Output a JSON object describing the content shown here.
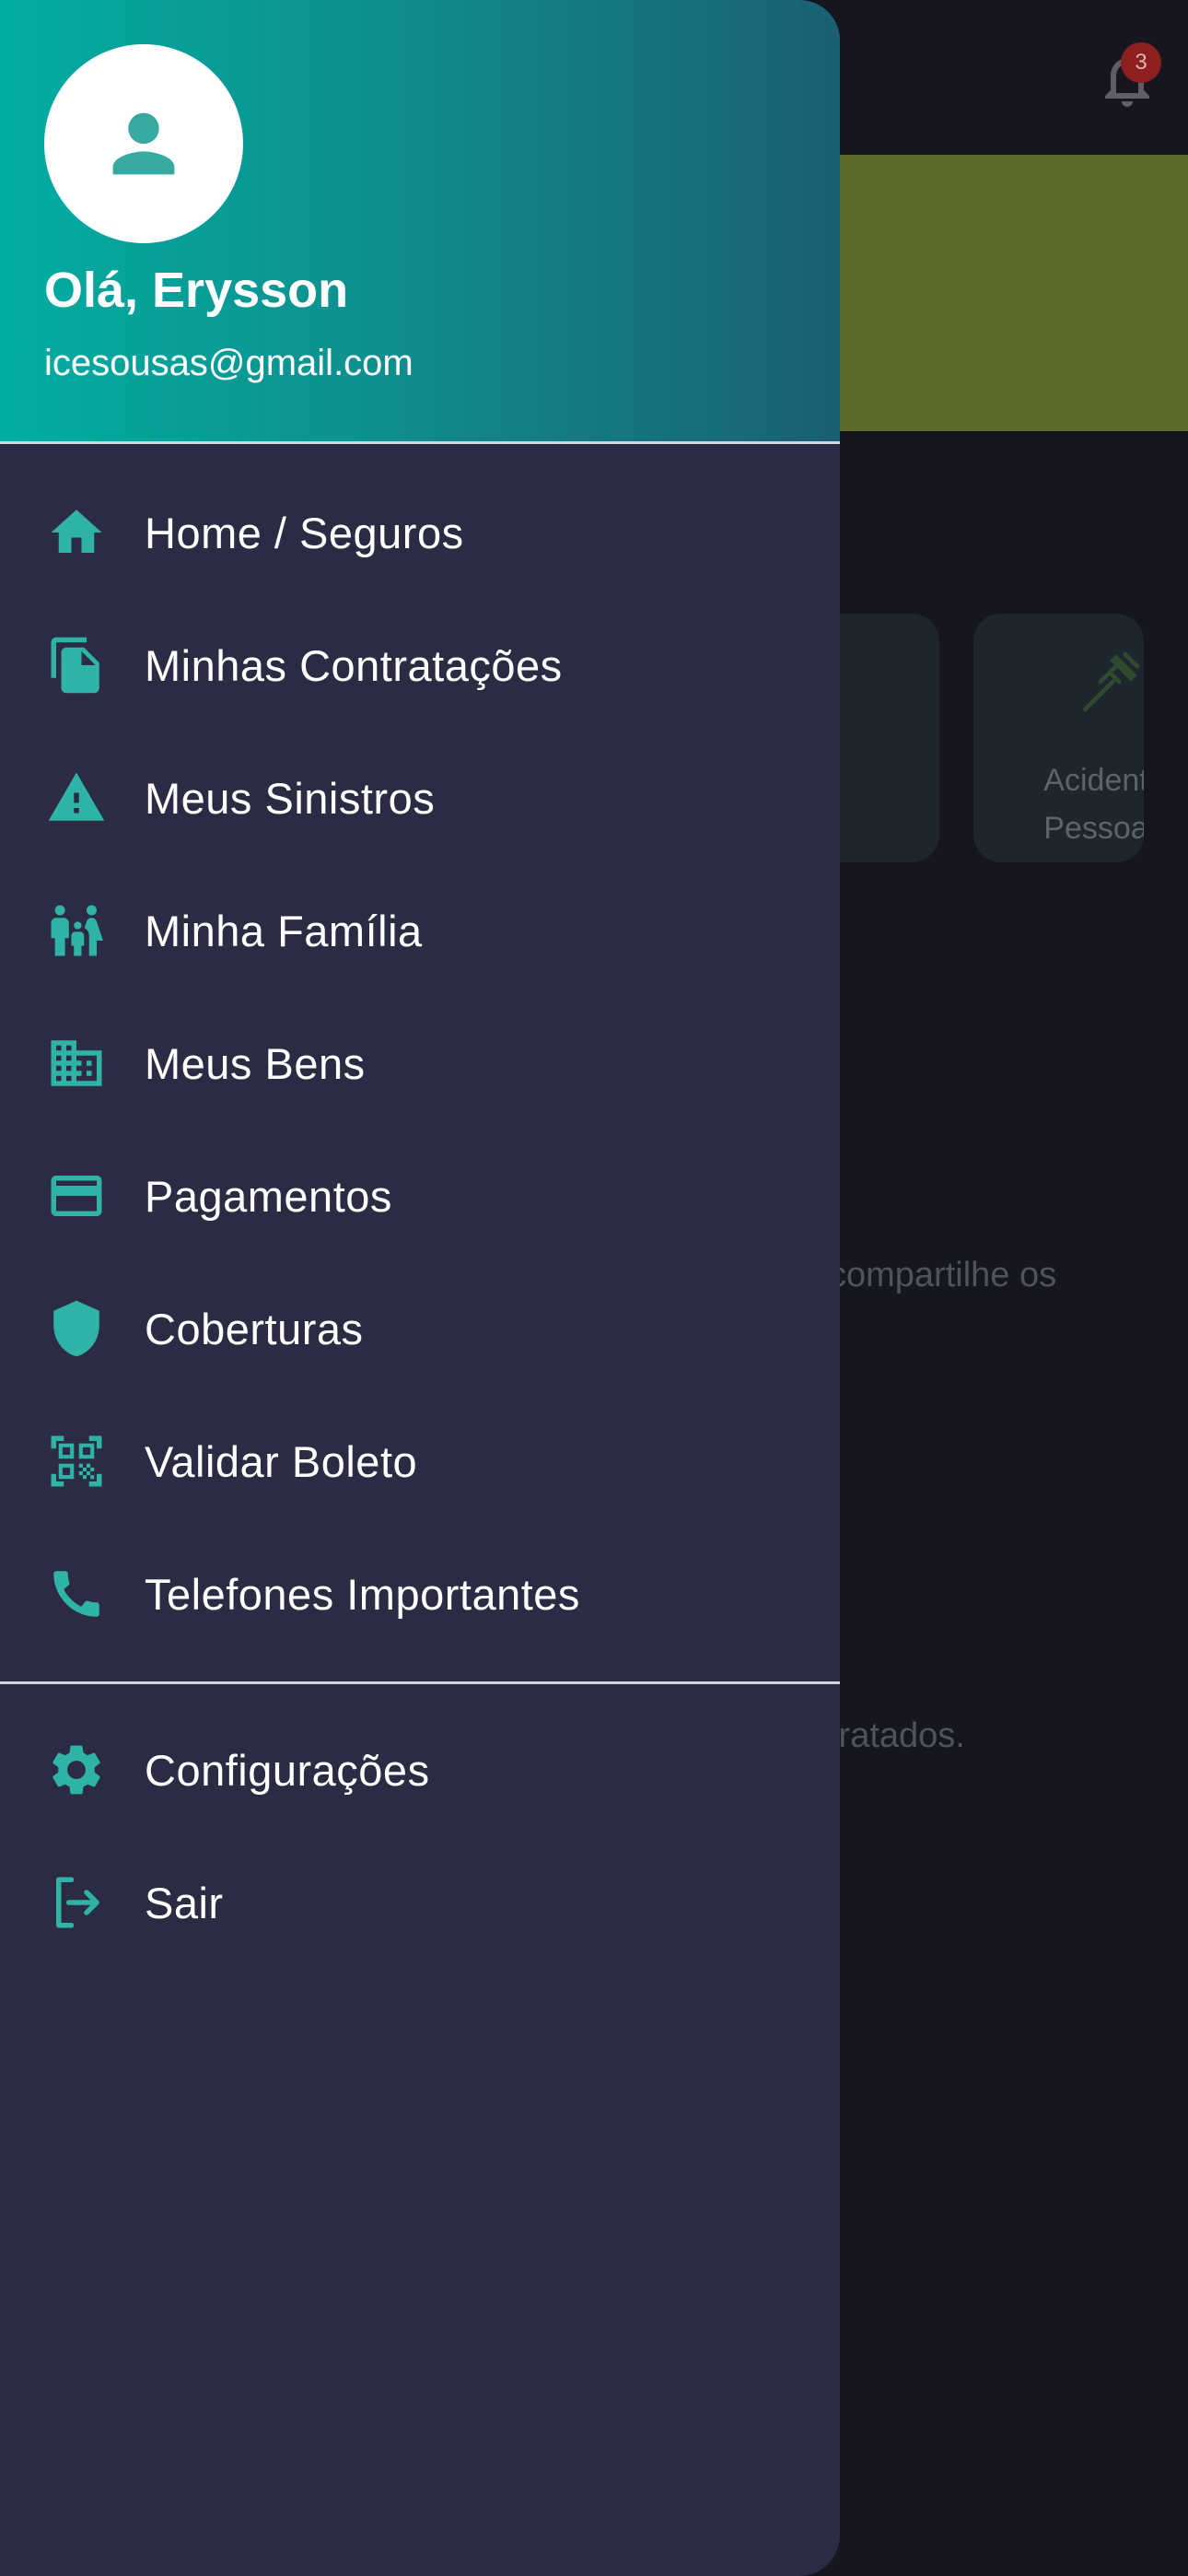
{
  "background": {
    "notification_count": "3",
    "card_label_line1": "Acident",
    "card_label_line2": "Pessoa",
    "text_line1": "compartilhe os",
    "text_line2": "tratados."
  },
  "drawer": {
    "greeting": "Olá, Erysson",
    "email": "icesousas@gmail.com",
    "menu": [
      {
        "label": "Home / Seguros",
        "icon": "home-icon"
      },
      {
        "label": "Minhas Contratações",
        "icon": "documents-icon"
      },
      {
        "label": "Meus Sinistros",
        "icon": "warning-icon"
      },
      {
        "label": "Minha Família",
        "icon": "family-icon"
      },
      {
        "label": "Meus Bens",
        "icon": "building-icon"
      },
      {
        "label": "Pagamentos",
        "icon": "credit-card-icon"
      },
      {
        "label": "Coberturas",
        "icon": "shield-icon"
      },
      {
        "label": "Validar Boleto",
        "icon": "qr-code-icon"
      },
      {
        "label": "Telefones Importantes",
        "icon": "phone-icon"
      }
    ],
    "footer_menu": [
      {
        "label": "Configurações",
        "icon": "gear-icon"
      },
      {
        "label": "Sair",
        "icon": "logout-icon"
      }
    ]
  },
  "colors": {
    "accent": "#2fb3a6",
    "drawer_bg": "#2b2b44",
    "header_gradient_start": "#02ada1",
    "header_gradient_end": "#1a5f73"
  }
}
